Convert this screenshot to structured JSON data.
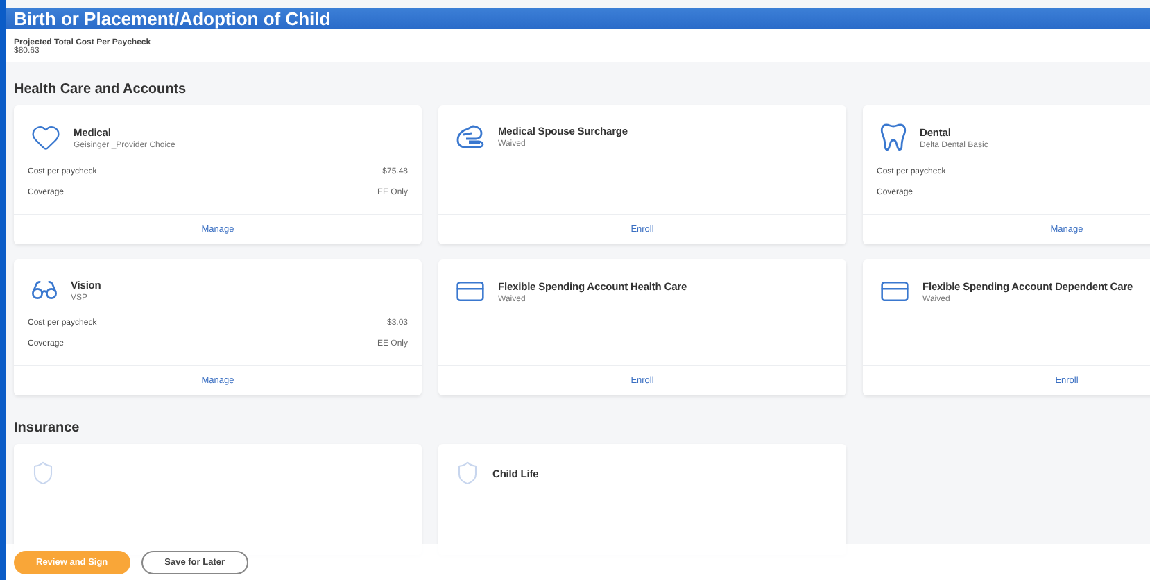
{
  "window": {
    "title": "Birth or Placement/Adoption of Child"
  },
  "summary": {
    "label": "Projected Total Cost Per Paycheck",
    "value": "$80.63"
  },
  "sections": [
    {
      "title": "Health Care and Accounts",
      "cards": [
        {
          "title": "Medical",
          "subtitle": "Geisinger _Provider Choice",
          "rows": [
            {
              "label": "Cost per paycheck",
              "value": "$75.48"
            },
            {
              "label": "Coverage",
              "value": "EE Only"
            }
          ],
          "action": "Manage"
        },
        {
          "title": "Medical Spouse Surcharge",
          "subtitle": "Waived",
          "action": "Enroll"
        },
        {
          "title": "Dental",
          "subtitle": "Delta Dental Basic",
          "rows": [
            {
              "label": "Cost per paycheck"
            },
            {
              "label": "Coverage"
            }
          ],
          "action": "Manage"
        },
        {
          "title": "Vision",
          "subtitle": "VSP",
          "rows": [
            {
              "label": "Cost per paycheck",
              "value": "$3.03"
            },
            {
              "label": "Coverage",
              "value": "EE Only"
            }
          ],
          "action": "Manage"
        },
        {
          "title": "Flexible Spending Account Health Care",
          "subtitle": "Waived",
          "action": "Enroll"
        },
        {
          "title": "Flexible Spending Account Dependent Care",
          "subtitle": "Waived",
          "action": "Enroll"
        }
      ]
    },
    {
      "title": "Insurance",
      "cards": [
        {
          "kind": "insurance"
        },
        {
          "kind": "insurance",
          "title": "Child Life"
        }
      ]
    }
  ],
  "buttons": [
    {
      "label": "Review and Sign",
      "kind": "primary"
    },
    {
      "label": "Save for Later",
      "kind": "secondary"
    }
  ]
}
